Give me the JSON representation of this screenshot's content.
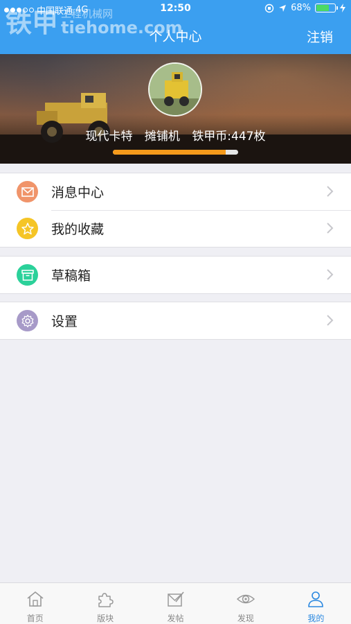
{
  "status_bar": {
    "carrier": "中国联通",
    "network": "4G",
    "time": "12:50",
    "battery": "68%"
  },
  "watermark": {
    "logo": "铁甲",
    "cn": "工程机械网",
    "url": "tiehome.com"
  },
  "nav": {
    "title": "个人中心",
    "right_action": "注销"
  },
  "profile": {
    "brand": "现代卡特",
    "category": "摊铺机",
    "coins": "铁甲币:447枚",
    "level_progress": 0.9
  },
  "menu_groups": [
    [
      {
        "label": "消息中心",
        "icon": "mail-icon",
        "color": "#f0946a"
      },
      {
        "label": "我的收藏",
        "icon": "star-icon",
        "color": "#f5c526"
      }
    ],
    [
      {
        "label": "草稿箱",
        "icon": "archive-icon",
        "color": "#2bd19a"
      }
    ],
    [
      {
        "label": "设置",
        "icon": "gear-icon",
        "color": "#a79ac8"
      }
    ]
  ],
  "tabs": [
    {
      "label": "首页",
      "icon": "home-icon"
    },
    {
      "label": "版块",
      "icon": "puzzle-icon"
    },
    {
      "label": "发帖",
      "icon": "compose-icon"
    },
    {
      "label": "发现",
      "icon": "eye-icon"
    },
    {
      "label": "我的",
      "icon": "user-icon",
      "active": true
    }
  ],
  "colors": {
    "nav": "#3b9ff0",
    "progress": "#f59a1b",
    "tab_active": "#2a88e0"
  }
}
